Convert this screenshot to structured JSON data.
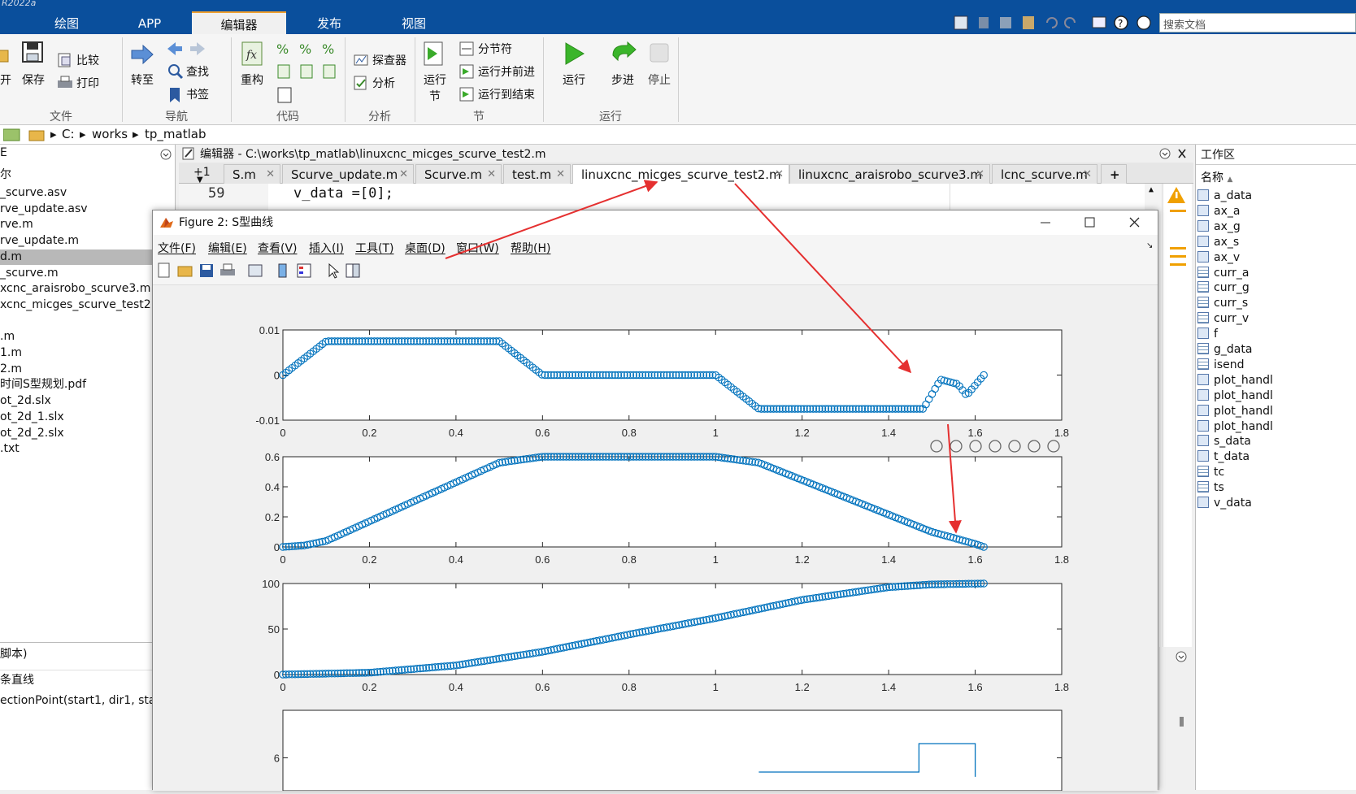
{
  "app": {
    "title_fragment": "R2022a",
    "ribbon_tabs": [
      "绘图",
      "APP",
      "编辑器",
      "发布",
      "视图"
    ],
    "active_tab": "编辑器",
    "search_placeholder": "搜索文档"
  },
  "ribbon": {
    "file": {
      "open": "开",
      "save": "保存",
      "compare": "比较",
      "print": "打印",
      "group": "文件"
    },
    "nav": {
      "goto": "转至",
      "find": "查找",
      "bookmark": "书签",
      "group": "导航"
    },
    "code": {
      "refactor": "重构",
      "group": "代码"
    },
    "analyze": {
      "explorer": "探查器",
      "analyze": "分析",
      "group": "分析"
    },
    "section": {
      "run_section_1": "运行",
      "run_section_2": "节",
      "break": "分节符",
      "run_advance": "运行并前进",
      "run_to_end": "运行到结束",
      "group": "节"
    },
    "run": {
      "run": "运行",
      "step": "步进",
      "stop": "停止",
      "group": "运行"
    }
  },
  "address": {
    "parts": [
      "C:",
      "works",
      "tp_matlab"
    ]
  },
  "left_panel": {
    "header": "E",
    "col": "尔",
    "files": [
      "_scurve.asv",
      "rve_update.asv",
      "rve.m",
      "rve_update.m",
      "d.m",
      "_scurve.m",
      "xcnc_araisrobo_scurve3.m",
      "xcnc_micges_scurve_test2.m",
      "",
      ".m",
      "1.m",
      "2.m",
      "时间S型规划.pdf",
      "ot_2d.slx",
      "ot_2d_1.slx",
      "ot_2d_2.slx",
      ".txt"
    ],
    "selected_index": 4,
    "details_title": "脚本)",
    "details_line1": "条直线",
    "details_line2": "ectionPoint(start1, dir1, star"
  },
  "editor": {
    "header": "编辑器 - C:\\works\\tp_matlab\\linuxcnc_micges_scurve_test2.m",
    "line_marker": "+1",
    "tabs": [
      "S.m",
      "Scurve_update.m",
      "Scurve.m",
      "test.m",
      "linuxcnc_micges_scurve_test2.m",
      "linuxcnc_araisrobo_scurve3.m",
      "lcnc_scurve.m"
    ],
    "active_tab_index": 4,
    "line_no": "59",
    "code_line": "v_data =[0];"
  },
  "workspace": {
    "title": "工作区",
    "col": "名称",
    "vars": [
      {
        "name": "a_data",
        "kind": "mat"
      },
      {
        "name": "ax_a",
        "kind": "mat"
      },
      {
        "name": "ax_g",
        "kind": "mat"
      },
      {
        "name": "ax_s",
        "kind": "mat"
      },
      {
        "name": "ax_v",
        "kind": "mat"
      },
      {
        "name": "curr_a",
        "kind": "tbl"
      },
      {
        "name": "curr_g",
        "kind": "tbl"
      },
      {
        "name": "curr_s",
        "kind": "tbl"
      },
      {
        "name": "curr_v",
        "kind": "tbl"
      },
      {
        "name": "f",
        "kind": "mat"
      },
      {
        "name": "g_data",
        "kind": "tbl"
      },
      {
        "name": "isend",
        "kind": "tbl"
      },
      {
        "name": "plot_handl",
        "kind": "mat"
      },
      {
        "name": "plot_handl",
        "kind": "mat"
      },
      {
        "name": "plot_handl",
        "kind": "mat"
      },
      {
        "name": "plot_handl",
        "kind": "mat"
      },
      {
        "name": "s_data",
        "kind": "mat"
      },
      {
        "name": "t_data",
        "kind": "mat"
      },
      {
        "name": "tc",
        "kind": "tbl"
      },
      {
        "name": "ts",
        "kind": "tbl"
      },
      {
        "name": "v_data",
        "kind": "mat"
      }
    ]
  },
  "figure": {
    "title": "Figure 2: S型曲线",
    "menu": [
      "文件(F)",
      "编辑(E)",
      "查看(V)",
      "插入(I)",
      "工具(T)",
      "桌面(D)",
      "窗口(W)",
      "帮助(H)"
    ]
  },
  "chart_data": [
    {
      "type": "scatter",
      "xlim": [
        0,
        1.8
      ],
      "ylim": [
        -0.01,
        0.01
      ],
      "xticks": [
        "0",
        "0.2",
        "0.4",
        "0.6",
        "0.8",
        "1",
        "1.2",
        "1.4",
        "1.6",
        "1.8"
      ],
      "yticks": [
        "0.01",
        "0",
        "-0.01"
      ],
      "series": [
        {
          "x": [
            0,
            0.1,
            0.5,
            0.6,
            1.0,
            1.1,
            1.48,
            1.52,
            1.56,
            1.58,
            1.62
          ],
          "y": [
            0,
            0.0075,
            0.0075,
            0,
            0,
            -0.0075,
            -0.0075,
            -0.001,
            -0.002,
            -0.0045,
            0
          ]
        }
      ]
    },
    {
      "type": "scatter",
      "xlim": [
        0,
        1.8
      ],
      "ylim": [
        0,
        0.6
      ],
      "xticks": [
        "0",
        "0.2",
        "0.4",
        "0.6",
        "0.8",
        "1",
        "1.2",
        "1.4",
        "1.6",
        "1.8"
      ],
      "yticks": [
        "0.6",
        "0.4",
        "0.2",
        "0"
      ],
      "series": [
        {
          "x": [
            0,
            0.05,
            0.1,
            0.5,
            0.6,
            1.0,
            1.1,
            1.5,
            1.55,
            1.6,
            1.62
          ],
          "y": [
            0,
            0.01,
            0.04,
            0.56,
            0.6,
            0.6,
            0.56,
            0.1,
            0.06,
            0.02,
            0
          ]
        }
      ]
    },
    {
      "type": "scatter",
      "xlim": [
        0,
        1.8
      ],
      "ylim": [
        0,
        100
      ],
      "xticks": [
        "0",
        "0.2",
        "0.4",
        "0.6",
        "0.8",
        "1",
        "1.2",
        "1.4",
        "1.6",
        "1.8"
      ],
      "yticks": [
        "100",
        "50",
        "0"
      ],
      "series": [
        {
          "x": [
            0,
            0.2,
            0.4,
            0.6,
            0.8,
            1.0,
            1.2,
            1.4,
            1.5,
            1.62
          ],
          "y": [
            0,
            2,
            10,
            25,
            44,
            62,
            82,
            96,
            99,
            100
          ]
        }
      ]
    },
    {
      "type": "line",
      "xlim": [
        0,
        1.8
      ],
      "ylim": [
        5,
        7
      ],
      "yticks": [
        "6"
      ],
      "series": [
        {
          "x": [
            1.1,
            1.47,
            1.47,
            1.6,
            1.6
          ],
          "y": [
            5.7,
            5.7,
            6.3,
            6.3,
            5.6
          ]
        }
      ]
    }
  ]
}
